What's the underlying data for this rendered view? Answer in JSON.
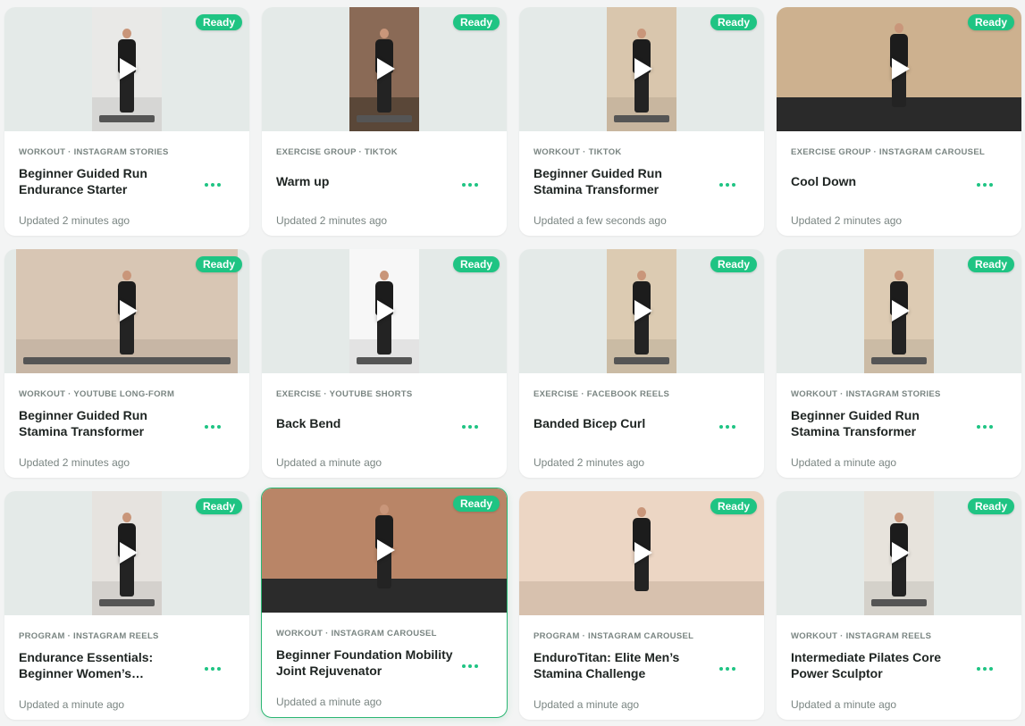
{
  "badge_label": "Ready",
  "colors": {
    "accent": "#1fc483",
    "selected_border": "#2bb673"
  },
  "cards": [
    {
      "meta": "WORKOUT · INSTAGRAM STORIES",
      "title": "Beginner Guided Run Endurance Starter",
      "updated": "Updated 2 minutes ago",
      "thumb": "narrow",
      "bg": "#e9e9e7"
    },
    {
      "meta": "EXERCISE GROUP · TIKTOK",
      "title": "Warm up",
      "updated": "Updated 2 minutes ago",
      "thumb": "narrow",
      "bg": "#8a6a56"
    },
    {
      "meta": "WORKOUT · TIKTOK",
      "title": "Beginner Guided Run Stamina Transformer",
      "updated": "Updated a few seconds ago",
      "thumb": "narrow",
      "bg": "#d9c6ad"
    },
    {
      "meta": "EXERCISE GROUP · INSTAGRAM CAROUSEL",
      "title": "Cool Down",
      "updated": "Updated 2 minutes ago",
      "thumb": "wide",
      "bg": "#cdb18f"
    },
    {
      "meta": "WORKOUT · YOUTUBE LONG-FORM",
      "title": "Beginner Guided Run Stamina Transformer",
      "updated": "Updated 2 minutes ago",
      "thumb": "mid",
      "bg": "#d8c6b4"
    },
    {
      "meta": "EXERCISE · YOUTUBE SHORTS",
      "title": "Back Bend",
      "updated": "Updated a minute ago",
      "thumb": "narrow",
      "bg": "#f7f7f7"
    },
    {
      "meta": "EXERCISE · FACEBOOK REELS",
      "title": "Banded Bicep Curl",
      "updated": "Updated 2 minutes ago",
      "thumb": "narrow",
      "bg": "#dccbb2"
    },
    {
      "meta": "WORKOUT · INSTAGRAM STORIES",
      "title": "Beginner Guided Run Stamina Transformer",
      "updated": "Updated a minute ago",
      "thumb": "narrow",
      "bg": "#ddcbb3"
    },
    {
      "meta": "PROGRAM · INSTAGRAM REELS",
      "title": "Endurance Essentials: Beginner Women’s…",
      "updated": "Updated a minute ago",
      "thumb": "narrow",
      "bg": "#e6e3df"
    },
    {
      "meta": "WORKOUT · INSTAGRAM CAROUSEL",
      "title": "Beginner Foundation Mobility Joint Rejuvenator",
      "updated": "Updated a minute ago",
      "thumb": "wide",
      "bg": "#b98567",
      "selected": true
    },
    {
      "meta": "PROGRAM · INSTAGRAM CAROUSEL",
      "title": "EnduroTitan: Elite Men’s Stamina Challenge",
      "updated": "Updated a minute ago",
      "thumb": "wide",
      "bg": "#ecd6c4"
    },
    {
      "meta": "WORKOUT · INSTAGRAM REELS",
      "title": "Intermediate Pilates Core Power Sculptor",
      "updated": "Updated a minute ago",
      "thumb": "narrow",
      "bg": "#e7e3dc"
    }
  ]
}
